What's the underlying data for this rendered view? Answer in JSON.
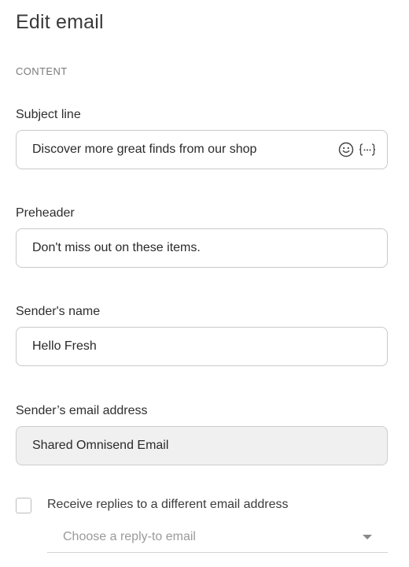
{
  "page": {
    "title": "Edit email",
    "section_label": "CONTENT"
  },
  "subject": {
    "label": "Subject line",
    "value": "Discover more great finds from our shop",
    "icons": [
      "emoji-icon",
      "personalization-tag-icon"
    ]
  },
  "preheader": {
    "label": "Preheader",
    "value": "Don't miss out on these items."
  },
  "sender_name": {
    "label": "Sender's name",
    "value": "Hello Fresh"
  },
  "sender_email": {
    "label": "Sender’s email address",
    "value": "Shared Omnisend Email",
    "disabled": true
  },
  "reply_to": {
    "checkbox_label": "Receive replies to a different email address",
    "checked": false,
    "select_placeholder": "Choose a reply-to email",
    "select_icon": "chevron-down-icon"
  }
}
